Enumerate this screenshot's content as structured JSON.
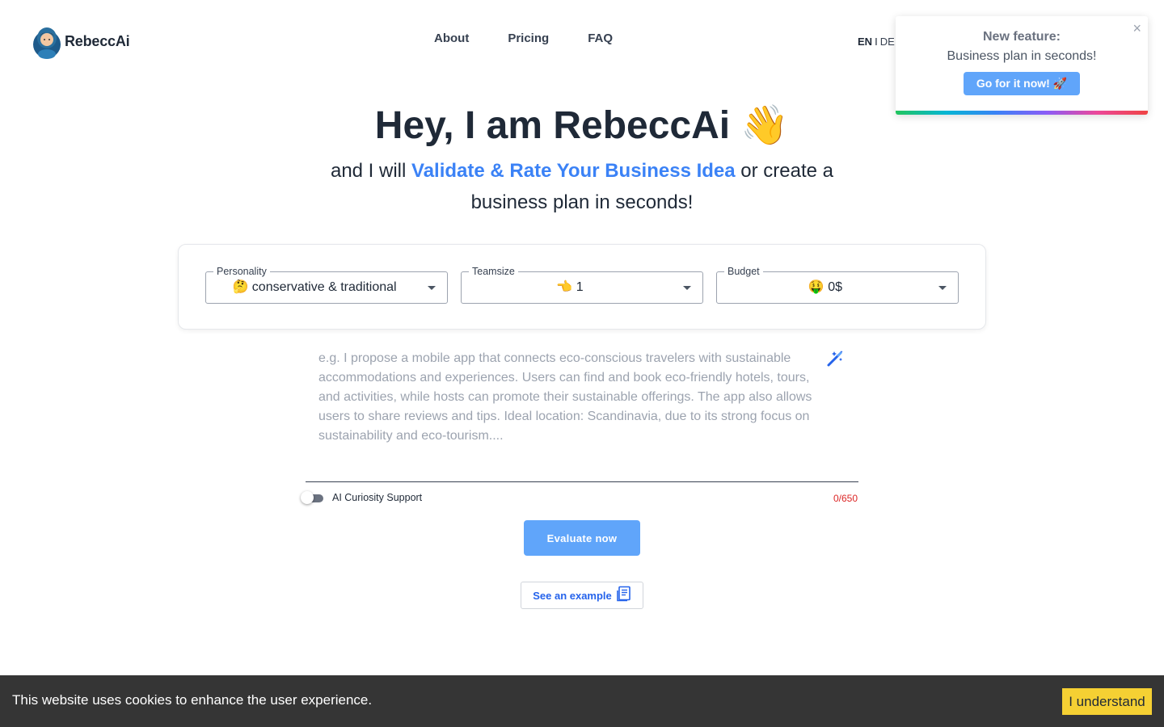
{
  "header": {
    "brand": "RebeccAi",
    "nav": [
      {
        "label": "About"
      },
      {
        "label": "Pricing"
      },
      {
        "label": "FAQ"
      }
    ],
    "lang_active": "EN",
    "lang_separator": "I",
    "lang_other": "DE"
  },
  "popup": {
    "title": "New feature:",
    "subtitle": "Business plan in seconds!",
    "button": "Go for it now! 🚀",
    "close": "×"
  },
  "hero": {
    "title": "Hey, I am RebeccAi 👋",
    "sub_before": "and I will ",
    "sub_highlight": "Validate & Rate Your Business Idea",
    "sub_after": " or create a business plan in seconds!"
  },
  "selects": {
    "personality": {
      "label": "Personality",
      "value": "🤔 conservative & traditional"
    },
    "teamsize": {
      "label": "Teamsize",
      "value": "👈 1"
    },
    "budget": {
      "label": "Budget",
      "value": "🤑 0$"
    }
  },
  "idea": {
    "placeholder": "e.g. I propose a mobile app that connects eco-conscious travelers with sustainable accommodations and experiences. Users can find and book eco-friendly hotels, tours, and activities, while hosts can promote their sustainable offerings. The app also allows users to share reviews and tips. Ideal location: Scandinavia, due to its strong focus on sustainability and eco-tourism....",
    "toggle_label": "AI Curiosity Support",
    "toggle_on": false,
    "counter": "0/650"
  },
  "actions": {
    "evaluate": "Evaluate now",
    "example": "See an example"
  },
  "cookie": {
    "text": "This website uses cookies to enhance the user experience.",
    "button": "I understand"
  },
  "colors": {
    "accent": "#3b82f6",
    "button": "#60a5fa",
    "cookie_bg": "#353535",
    "cookie_btn": "#f5d033",
    "counter": "#dc2626"
  }
}
